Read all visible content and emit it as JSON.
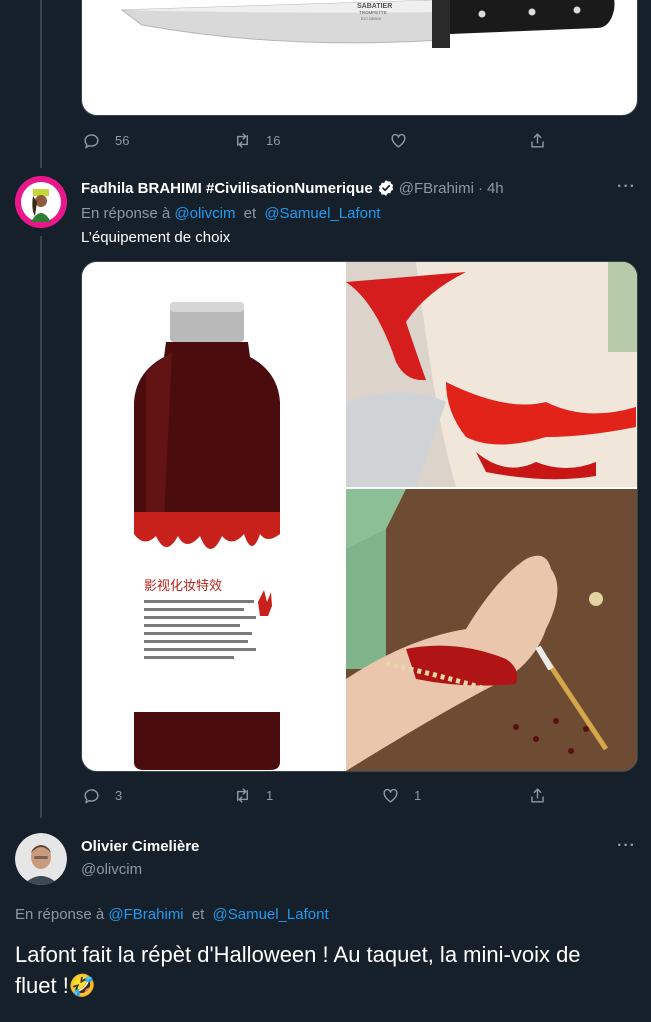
{
  "top_tweet": {
    "knife_brand": "SABATIER",
    "knife_subbrand": "TROMPETTE",
    "knife_model": "ECI 15MoV",
    "actions": {
      "reply_count": "56",
      "retweet_count": "16",
      "like_count": "",
      "share_label": ""
    }
  },
  "tweet1": {
    "display_name": "Fadhila BRAHIMI #CivilisationNumerique",
    "handle": "@FBrahimi",
    "dot": "·",
    "time": "4h",
    "reply_prefix": "En réponse à",
    "reply_user1": "@olivcim",
    "reply_and": "et",
    "reply_user2": "@Samuel_Lafont",
    "text": "L’équipement de choix",
    "bottle_label": "影视化妆特效",
    "actions": {
      "reply_count": "3",
      "retweet_count": "1",
      "like_count": "1"
    }
  },
  "tweet2": {
    "display_name": "Olivier Cimelière",
    "handle": "@olivcim",
    "reply_prefix": "En réponse à",
    "reply_user1": "@FBrahimi",
    "reply_and": "et",
    "reply_user2": "@Samuel_Lafont",
    "text": "Lafont fait la répèt d'Halloween ! Au taquet, la mini-voix de fluet !",
    "emoji": "🤣"
  },
  "icons": [
    "reply-icon",
    "retweet-icon",
    "like-icon",
    "share-icon",
    "more-icon",
    "verified-icon"
  ],
  "colors": {
    "background": "#15202b",
    "link": "#1d9bf0",
    "muted": "#8b98a5",
    "divider": "#38444d"
  }
}
